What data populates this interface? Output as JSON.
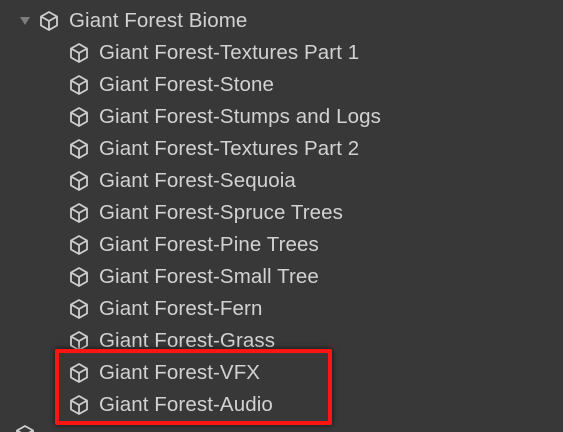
{
  "hierarchy": {
    "top_partial_label": "",
    "parent": {
      "label": "Giant Forest Biome",
      "icon": "prefab-cube-icon",
      "expanded": true
    },
    "children": [
      {
        "label": "Giant Forest-Textures Part 1",
        "icon": "prefab-cube-icon"
      },
      {
        "label": "Giant Forest-Stone",
        "icon": "prefab-cube-icon"
      },
      {
        "label": "Giant Forest-Stumps and Logs",
        "icon": "prefab-cube-icon"
      },
      {
        "label": "Giant Forest-Textures Part 2",
        "icon": "prefab-cube-icon"
      },
      {
        "label": "Giant Forest-Sequoia",
        "icon": "prefab-cube-icon"
      },
      {
        "label": "Giant Forest-Spruce Trees",
        "icon": "prefab-cube-icon"
      },
      {
        "label": "Giant Forest-Pine Trees",
        "icon": "prefab-cube-icon"
      },
      {
        "label": "Giant Forest-Small Tree",
        "icon": "prefab-cube-icon"
      },
      {
        "label": "Giant Forest-Fern",
        "icon": "prefab-cube-icon"
      },
      {
        "label": "Giant Forest-Grass",
        "icon": "prefab-cube-icon"
      },
      {
        "label": "Giant Forest-VFX",
        "icon": "prefab-cube-icon"
      },
      {
        "label": "Giant Forest-Audio",
        "icon": "prefab-cube-icon"
      }
    ],
    "bottom_partial_label": ""
  },
  "colors": {
    "background": "#383838",
    "text": "#d2d2d2",
    "highlight_border": "#ff1414"
  }
}
